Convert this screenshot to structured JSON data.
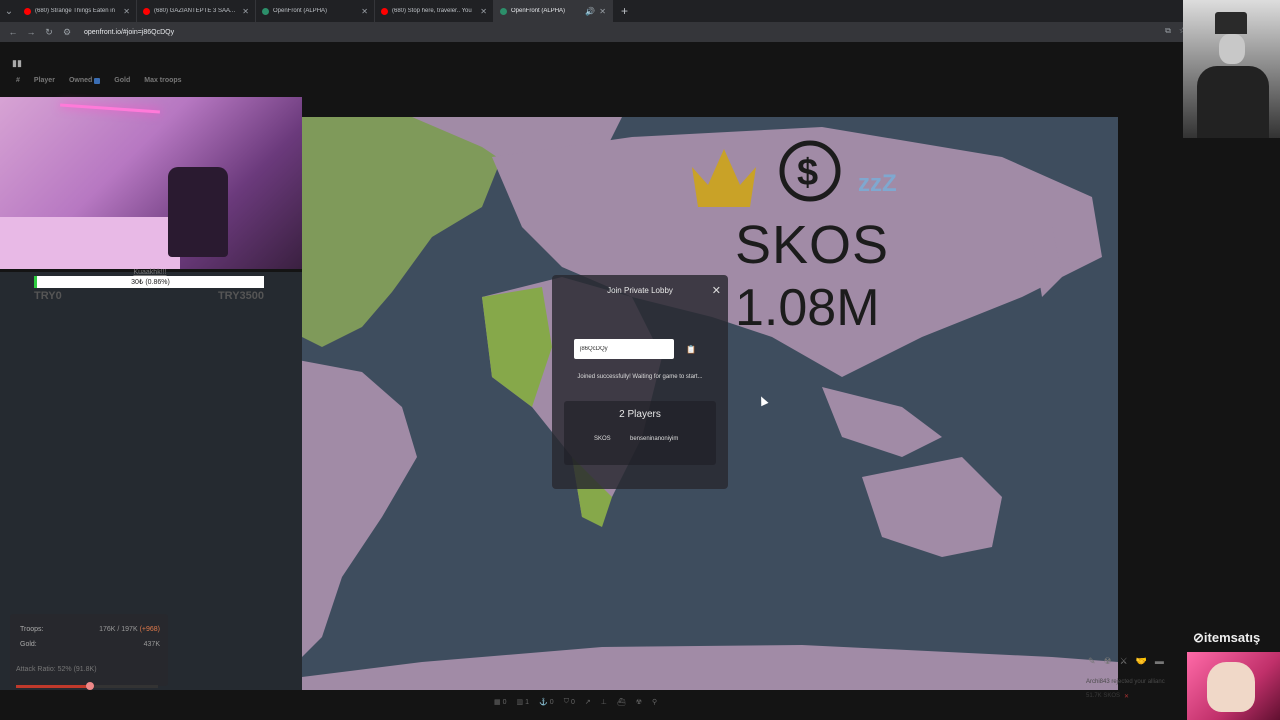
{
  "browser": {
    "tabs": [
      {
        "title": "(680) Strange Things Eaten in",
        "fav_color": "#ff0000",
        "close": "✕"
      },
      {
        "title": "(680) GAZİANTEPTE 3 SAATTE",
        "fav_color": "#ff0000",
        "close": "✕"
      },
      {
        "title": "OpenFront (ALPHA)",
        "fav_color": "#2c8f6a",
        "close": "✕"
      },
      {
        "title": "(680) Stop here, traveler.. You",
        "fav_color": "#ff0000",
        "close": "✕"
      },
      {
        "title": "OpenFront (ALPHA)",
        "fav_color": "#2c8f6a",
        "close": "✕",
        "active": true
      }
    ],
    "new_tab": "+",
    "url": "openfront.io/#join=j86QcDQy"
  },
  "leaderboard": {
    "headers": [
      "#",
      "Player",
      "Owned",
      "Gold",
      "Max troops"
    ]
  },
  "donation": {
    "name": "Kuaakhk!!!",
    "progress_text": "30₺ (0.86%)",
    "progress_fraction": 0.0086,
    "min_label": "TRY0",
    "max_label": "TRY3500"
  },
  "modal": {
    "title": "Join Private Lobby",
    "close": "✕",
    "lobby_code": "j86QcDQy",
    "copy_icon": "📋",
    "status": "Joined successfully! Waiting for game to start...",
    "players_title": "2 Players",
    "players": [
      "SKOS",
      "benseninanoniyim"
    ]
  },
  "overlay": {
    "player_name": "SKOS",
    "troops": "1.08M"
  },
  "stats": {
    "troops_label": "Troops:",
    "troops_value": "176K / 197K",
    "troops_plus": "(+968)",
    "gold_label": "Gold:",
    "gold_value": "437K",
    "attack_ratio": "Attack Ratio: 52% (91.8K)",
    "attack_ratio_fraction": 0.52
  },
  "toolbar": {
    "items": [
      {
        "icon": "city-icon",
        "count": "0"
      },
      {
        "icon": "factory-icon",
        "count": "1"
      },
      {
        "icon": "port-icon",
        "count": "0"
      },
      {
        "icon": "defense-icon",
        "count": "0"
      }
    ]
  },
  "events": {
    "message": "Archi843 rejected your allianc",
    "footer": "51.7K SKOS",
    "footer_close": "✕"
  },
  "sponsor": "⊘itemsatış"
}
